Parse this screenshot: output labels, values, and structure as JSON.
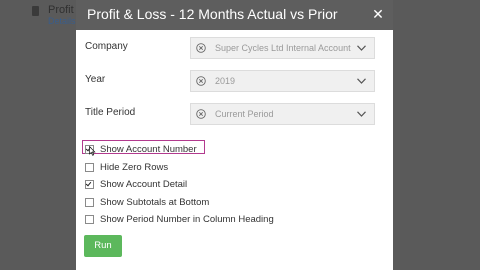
{
  "background": {
    "title": "Profit",
    "subtitle": "Details"
  },
  "modal": {
    "title": "Profit & Loss - 12 Months Actual vs Prior",
    "close_icon": "close-icon"
  },
  "form": {
    "company": {
      "label": "Company",
      "value": "Super Cycles Ltd Internal Account"
    },
    "year": {
      "label": "Year",
      "value": "2019"
    },
    "title_period": {
      "label": "Title Period",
      "value": "Current Period"
    }
  },
  "options": [
    {
      "label": "Show Account Number",
      "checked": true
    },
    {
      "label": "Hide Zero Rows",
      "checked": false
    },
    {
      "label": "Show Account Detail",
      "checked": true
    },
    {
      "label": "Show Subtotals at Bottom",
      "checked": false
    },
    {
      "label": "Show Period Number in Column Heading",
      "checked": false
    }
  ],
  "actions": {
    "run_label": "Run"
  },
  "colors": {
    "header_bg": "#5e5e5e",
    "run_button": "#5cb85c",
    "highlight": "#b23a8e"
  }
}
